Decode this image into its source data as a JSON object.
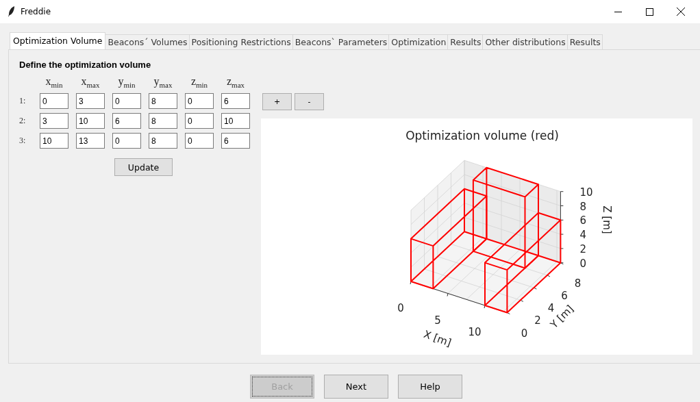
{
  "window": {
    "title": "Freddie"
  },
  "tabs": [
    {
      "label": "Optimization Volume",
      "selected": true
    },
    {
      "label": "Beacons´ Volumes",
      "selected": false
    },
    {
      "label": "Positioning Restrictions",
      "selected": false
    },
    {
      "label": "Beacons` Parameters",
      "selected": false
    },
    {
      "label": "Optimization",
      "selected": false
    },
    {
      "label": "Results",
      "selected": false
    },
    {
      "label": "Other distributions",
      "selected": false
    },
    {
      "label": "Results",
      "selected": false
    }
  ],
  "section_title": "Define the optimization volume",
  "columns": [
    "x$_{min}$",
    "x$_{max}$",
    "y$_{min}$",
    "y$_{max}$",
    "z$_{min}$",
    "z$_{max}$"
  ],
  "rows": [
    {
      "label": "1:",
      "values": [
        "0",
        "3",
        "0",
        "8",
        "0",
        "6"
      ]
    },
    {
      "label": "2:",
      "values": [
        "3",
        "10",
        "6",
        "8",
        "0",
        "10"
      ]
    },
    {
      "label": "3:",
      "values": [
        "10",
        "13",
        "0",
        "8",
        "0",
        "6"
      ]
    }
  ],
  "update_button": "Update",
  "row_buttons": [
    "+",
    "-"
  ],
  "plot": {
    "title": "Optimization volume (red)",
    "xlabel": "X [m]",
    "ylabel": "Y [m]",
    "zlabel": "Z [m]",
    "xticks": [
      "0",
      "5",
      "10"
    ],
    "yticks": [
      "0",
      "2",
      "4",
      "6",
      "8"
    ],
    "zticks": [
      "10",
      "8",
      "6",
      "4",
      "2",
      "0"
    ]
  },
  "footer_buttons": [
    {
      "label": "Back",
      "disabled": true
    },
    {
      "label": "Next",
      "disabled": false
    },
    {
      "label": "Help",
      "disabled": false
    }
  ]
}
